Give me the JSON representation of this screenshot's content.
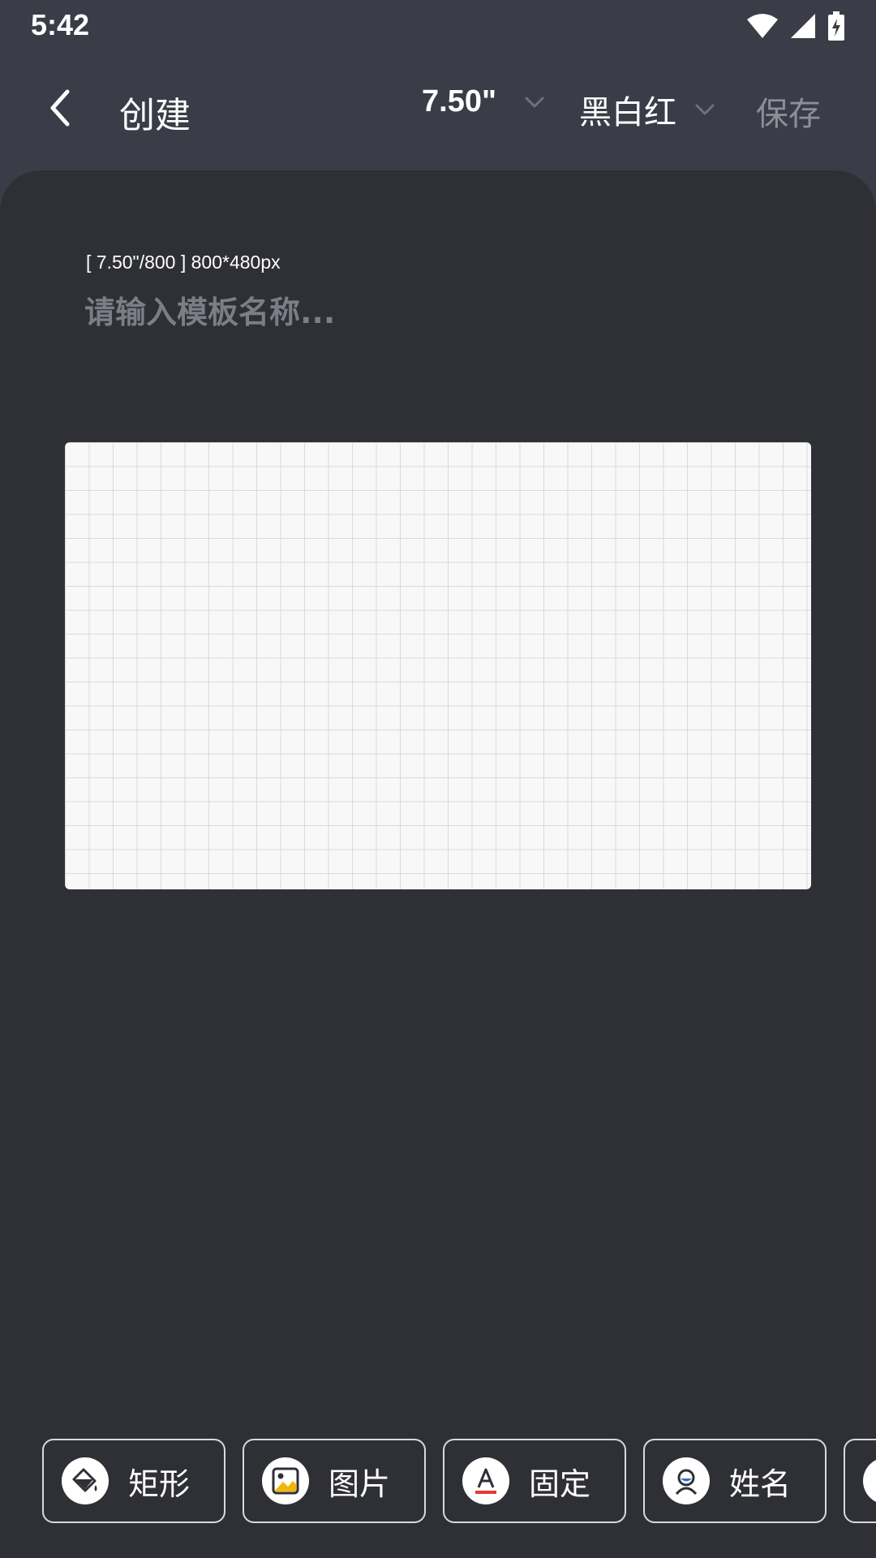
{
  "status_bar": {
    "time": "5:42",
    "icons": [
      "wifi-icon",
      "signal-icon",
      "battery-icon"
    ]
  },
  "app_bar": {
    "title": "创建",
    "size_value": "7.50\"",
    "color_mode": "黑白红",
    "save_label": "保存",
    "back_icon": "chevron-left-icon"
  },
  "template": {
    "info": "[ 7.50\"/800 ] 800*480px",
    "name_placeholder": "请输入模板名称..."
  },
  "toolbar": {
    "items": [
      {
        "label": "矩形",
        "icon": "paint-bucket-icon"
      },
      {
        "label": "图片",
        "icon": "image-icon"
      },
      {
        "label": "固定",
        "icon": "text-icon"
      },
      {
        "label": "姓名",
        "icon": "person-icon"
      }
    ]
  },
  "colors": {
    "header_bg": "#3a3d48",
    "panel_bg": "#2f3035",
    "canvas_bg": "#f8f8f8",
    "muted_text": "#8c8f98",
    "accent_red": "#e53935",
    "accent_blue": "#2f6bd8",
    "accent_yellow": "#f2b705"
  }
}
